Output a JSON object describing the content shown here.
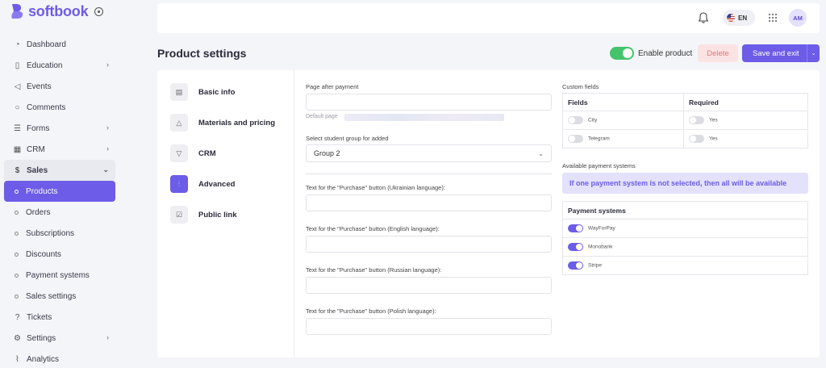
{
  "app": {
    "name": "softbook"
  },
  "sidebar": {
    "items": [
      {
        "label": "Dashboard",
        "icon": "dashboard-icon",
        "chevron": false
      },
      {
        "label": "Education",
        "icon": "book-icon",
        "chevron": true
      },
      {
        "label": "Events",
        "icon": "megaphone-icon",
        "chevron": false
      },
      {
        "label": "Comments",
        "icon": "chat-icon",
        "chevron": false
      },
      {
        "label": "Forms",
        "icon": "list-icon",
        "chevron": true
      },
      {
        "label": "CRM",
        "icon": "grid-icon",
        "chevron": true
      },
      {
        "label": "Sales",
        "icon": "dollar-icon",
        "chevron": true,
        "expanded": true
      },
      {
        "label": "Products",
        "active": true
      },
      {
        "label": "Orders"
      },
      {
        "label": "Subscriptions"
      },
      {
        "label": "Discounts"
      },
      {
        "label": "Payment systems"
      },
      {
        "label": "Sales settings"
      },
      {
        "label": "Tickets",
        "icon": "help-icon",
        "chevron": false
      },
      {
        "label": "Settings",
        "icon": "gear-icon",
        "chevron": true
      },
      {
        "label": "Analytics",
        "icon": "analytics-icon",
        "chevron": false
      }
    ]
  },
  "topbar": {
    "language": "EN",
    "avatar_initials": "AM"
  },
  "header": {
    "title": "Product settings",
    "enable_label": "Enable product",
    "enable_on": true,
    "delete_label": "Delete",
    "save_label": "Save and exit"
  },
  "tabs": [
    {
      "label": "Basic info",
      "icon": "document-icon"
    },
    {
      "label": "Materials and pricing",
      "icon": "shapes-icon"
    },
    {
      "label": "CRM",
      "icon": "filter-icon"
    },
    {
      "label": "Advanced",
      "icon": "sliders-icon",
      "active": true
    },
    {
      "label": "Public link",
      "icon": "checkbox-icon"
    }
  ],
  "form": {
    "page_after_payment_label": "Page after payment",
    "page_after_payment_value": "",
    "default_page_hint": "Default page",
    "student_group_label": "Select student group for added",
    "student_group_value": "Group 2",
    "purchase_ua_label": "Text for the \"Purchase\" button (Ukrainian language):",
    "purchase_en_label": "Text for the \"Purchase\" button (English language):",
    "purchase_ru_label": "Text for the \"Purchase\" button (Russian language):",
    "purchase_pl_label": "Text for the \"Purchase\" button (Polish language):"
  },
  "custom_fields": {
    "title": "Custom fields",
    "col_fields": "Fields",
    "col_required": "Required",
    "rows": [
      {
        "field": "City",
        "field_on": false,
        "required": "Yes",
        "required_on": false
      },
      {
        "field": "Telegram",
        "field_on": false,
        "required": "Yes",
        "required_on": false
      }
    ]
  },
  "payment": {
    "title": "Available payment systems",
    "notice": "If one payment system is not selected, then all will be available",
    "col_header": "Payment systems",
    "systems": [
      {
        "name": "WayForPay",
        "on": true
      },
      {
        "name": "Monobank",
        "on": true
      },
      {
        "name": "Stripe",
        "on": true
      }
    ]
  },
  "colors": {
    "accent": "#6c5ce7",
    "enable": "#43c46a",
    "danger_bg": "#fbe3e3"
  }
}
